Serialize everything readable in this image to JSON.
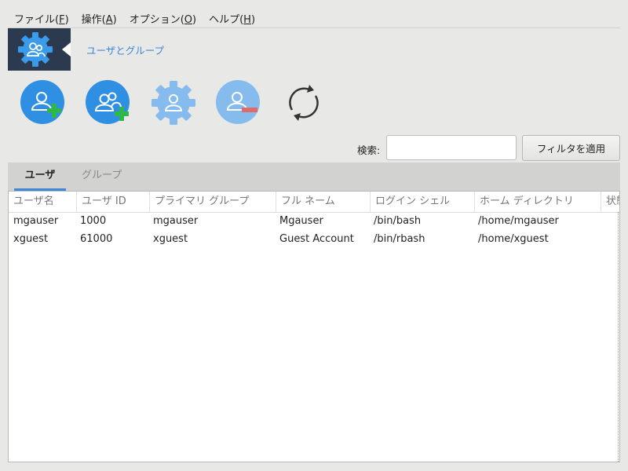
{
  "menu": [
    {
      "label": "ファイル(",
      "mnemonic": "F",
      "suffix": ")"
    },
    {
      "label": "操作(",
      "mnemonic": "A",
      "suffix": ")"
    },
    {
      "label": "オプション(",
      "mnemonic": "O",
      "suffix": ")"
    },
    {
      "label": "ヘルプ(",
      "mnemonic": "H",
      "suffix": ")"
    }
  ],
  "banner": {
    "title": "ユーザとグループ",
    "icon": "users-gear-icon"
  },
  "toolbar": {
    "tools": [
      {
        "name": "add-user",
        "icon": "add-user-icon"
      },
      {
        "name": "add-group",
        "icon": "add-group-icon"
      },
      {
        "name": "edit",
        "icon": "gear-icon"
      },
      {
        "name": "delete",
        "icon": "delete-user-icon"
      },
      {
        "name": "refresh",
        "icon": "refresh-icon"
      }
    ]
  },
  "search": {
    "label": "検索:",
    "value": "",
    "button": "フィルタを適用"
  },
  "tabs": [
    {
      "label": "ユーザ",
      "active": true
    },
    {
      "label": "グループ",
      "active": false
    }
  ],
  "table": {
    "columns": [
      "ユーザ名",
      "ユーザ ID",
      "プライマリ グループ",
      "フル ネーム",
      "ログイン シェル",
      "ホーム ディレクトリ",
      "状態"
    ],
    "rows": [
      [
        "mgauser",
        "1000",
        "mgauser",
        "Mgauser",
        "/bin/bash",
        "/home/mgauser"
      ],
      [
        "xguest",
        "61000",
        "xguest",
        "Guest Account",
        "/bin/rbash",
        "/home/xguest"
      ]
    ]
  },
  "colors": {
    "accent": "#3d87d9",
    "banner_bg": "#2b3a4e",
    "icon_blue": "#3a9bea",
    "add_green": "#2eb84b",
    "delete_red": "#e06a6a"
  }
}
